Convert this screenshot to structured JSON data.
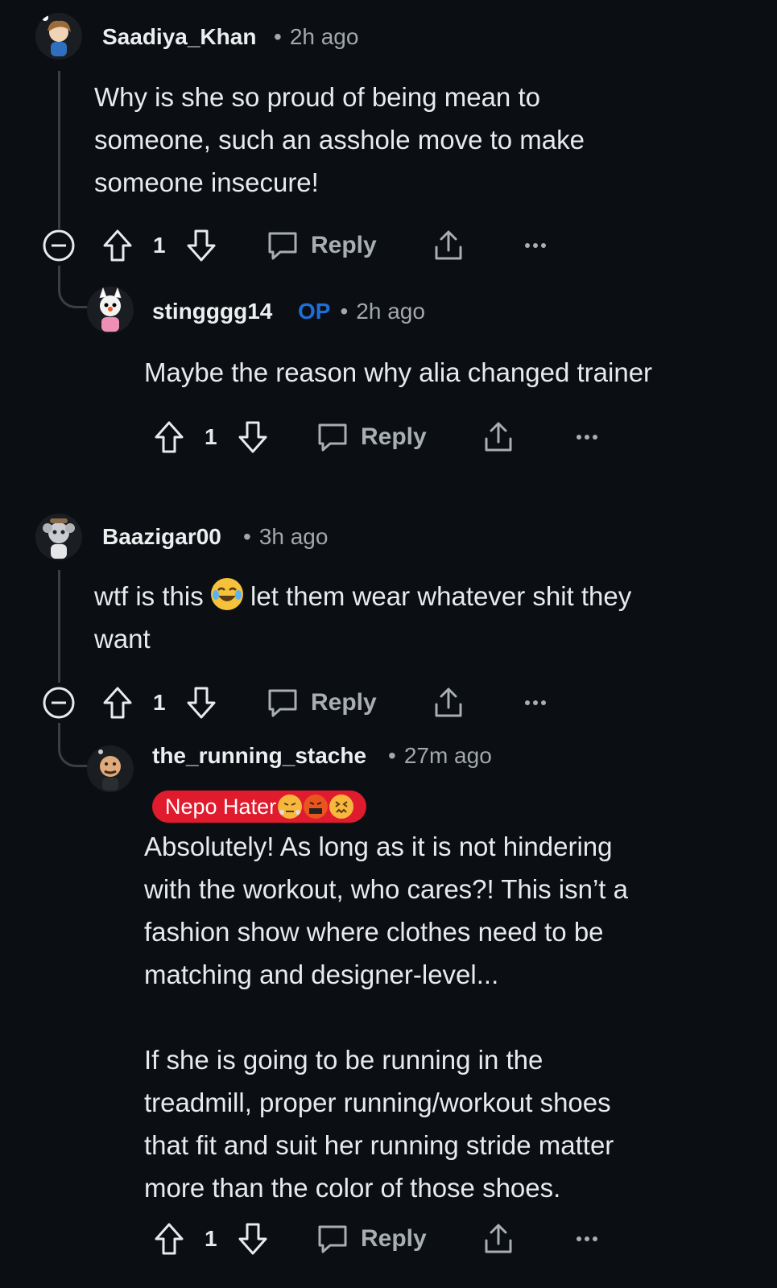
{
  "comments": [
    {
      "username": "Saadiya_Khan",
      "time": "2h ago",
      "body": "Why is she so proud of being mean to\nsomeone, such an asshole move to make\nsomeone insecure!",
      "votes": "1",
      "reply_label": "Reply",
      "replies": [
        {
          "username": "stingggg14",
          "op_badge": "OP",
          "time": "2h ago",
          "body": "Maybe the reason why alia changed trainer",
          "votes": "1",
          "reply_label": "Reply"
        }
      ]
    },
    {
      "username": "Baazigar00",
      "time": "3h ago",
      "body_before_emoji": "wtf is this ",
      "emoji": "face-with-tears-of-joy",
      "body_after_emoji": " let them wear whatever shit they\nwant",
      "votes": "1",
      "reply_label": "Reply",
      "replies": [
        {
          "username": "the_running_stache",
          "time": "27m ago",
          "flair": "Nepo Hater",
          "flair_emojis": [
            "face-with-steam",
            "face-with-symbols",
            "confounded-face"
          ],
          "body": "Absolutely! As long as it is not hindering\nwith the workout, who cares?! This isn’t a\nfashion show where clothes need to be\nmatching and designer-level...\n\nIf she is going to be running in the\ntreadmill, proper running/workout shoes\nthat fit and suit her running stride matter\nmore than the color of those shoes.",
          "votes": "1",
          "reply_label": "Reply"
        }
      ]
    }
  ],
  "colors": {
    "background": "#0b0e12",
    "op": "#1e6fd9",
    "flair": "#e01b2d",
    "muted": "#a3a8ad"
  }
}
